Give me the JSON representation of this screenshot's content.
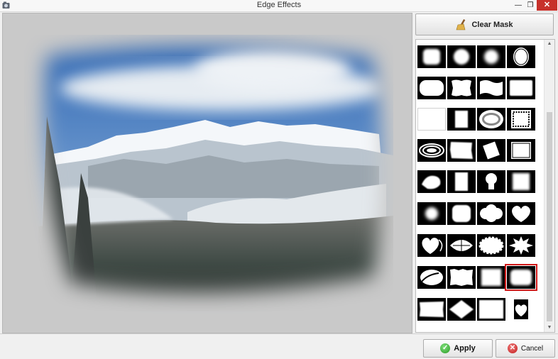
{
  "window": {
    "title": "Edge Effects",
    "minimize_glyph": "—",
    "restore_glyph": "❐",
    "close_glyph": "✕"
  },
  "sidebar": {
    "clear_mask_label": "Clear Mask",
    "clear_mask_icon": "broom-icon",
    "selected_shape_index": 31,
    "shapes": [
      "burst-square",
      "burst-circle",
      "burst-radial",
      "oval-frame",
      "rounded-rect",
      "wavy-label",
      "ribbon-rect",
      "soft-rect",
      "plain-rect",
      "rough-rect",
      "ellipse-ring",
      "ornate-frame",
      "swirl-oval",
      "torn-rect",
      "tilted-square",
      "square-frame",
      "brush-stroke",
      "tall-rough-rect",
      "light-bulb",
      "grunge-square",
      "burst-small",
      "rounded-square",
      "cloud-bubble",
      "heart",
      "heart-swirl",
      "floral-burst",
      "scalloped-oval",
      "starburst",
      "oval-swirl",
      "torn-paper",
      "soft-square",
      "blur-rect",
      "rough-wide-rect",
      "diamond",
      "blur-frame",
      "heart-small"
    ]
  },
  "buttons": {
    "apply_label": "Apply",
    "apply_icon": "check-icon",
    "cancel_label": "Cancel",
    "cancel_icon": "cancel-icon"
  },
  "colors": {
    "selection": "#d01818",
    "close_button": "#c7312b",
    "sky": "#4f86c6"
  }
}
